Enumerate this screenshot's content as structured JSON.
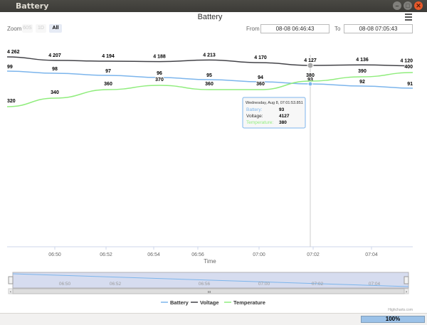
{
  "window": {
    "title": "Battery",
    "close_label": "✕",
    "min_label": "–",
    "max_label": "□"
  },
  "chart": {
    "title": "Battery"
  },
  "zoom": {
    "label": "Zoom",
    "buttons": [
      "60S",
      "1D",
      "All"
    ],
    "active": "All"
  },
  "range": {
    "from_label": "From",
    "from_value": "08-08 06:46:43",
    "to_label": "To",
    "to_value": "08-08 07:05:43"
  },
  "axis": {
    "xlabel": "Time",
    "ticks": [
      "06:50",
      "06:52",
      "06:54",
      "06:56",
      "07:00",
      "07:02",
      "07:04"
    ]
  },
  "navigator": {
    "ticks": [
      "06:50",
      "06:52",
      "06:56",
      "07:00",
      "07:02",
      "07:04"
    ],
    "left_arrow": "‹",
    "right_arrow": "›",
    "grip": "III"
  },
  "legend": [
    "Battery",
    "Voltage",
    "Temperature"
  ],
  "colors": {
    "battery": "#7cb5ec",
    "voltage": "#434348",
    "temperature": "#90ed7d",
    "navigator_fill": "#d6dcef"
  },
  "credits": "Highcharts.com",
  "tooltip": {
    "header": "Wednesday, Aug 8, 07:01:53.851",
    "rows": [
      {
        "label": "Battery:",
        "value": "93"
      },
      {
        "label": "Voltage:",
        "value": "4127"
      },
      {
        "label": "Temperature:",
        "value": "380"
      }
    ]
  },
  "progress": {
    "value": 1.0,
    "text": "100%"
  },
  "chart_data": {
    "type": "line",
    "xlabel": "Time",
    "x": [
      "06:46:43",
      "06:50",
      "06:53",
      "06:54:30",
      "06:57",
      "06:59:30",
      "07:01:53",
      "07:04",
      "07:05:43"
    ],
    "series": [
      {
        "name": "Voltage",
        "values": [
          4262,
          4207,
          4194,
          4188,
          4213,
          4170,
          4127,
          4136,
          4120
        ]
      },
      {
        "name": "Battery",
        "values": [
          99,
          98,
          97,
          96,
          95,
          94,
          93,
          92,
          91
        ]
      },
      {
        "name": "Temperature",
        "values": [
          320,
          340,
          360,
          370,
          360,
          360,
          380,
          390,
          400
        ]
      }
    ]
  }
}
